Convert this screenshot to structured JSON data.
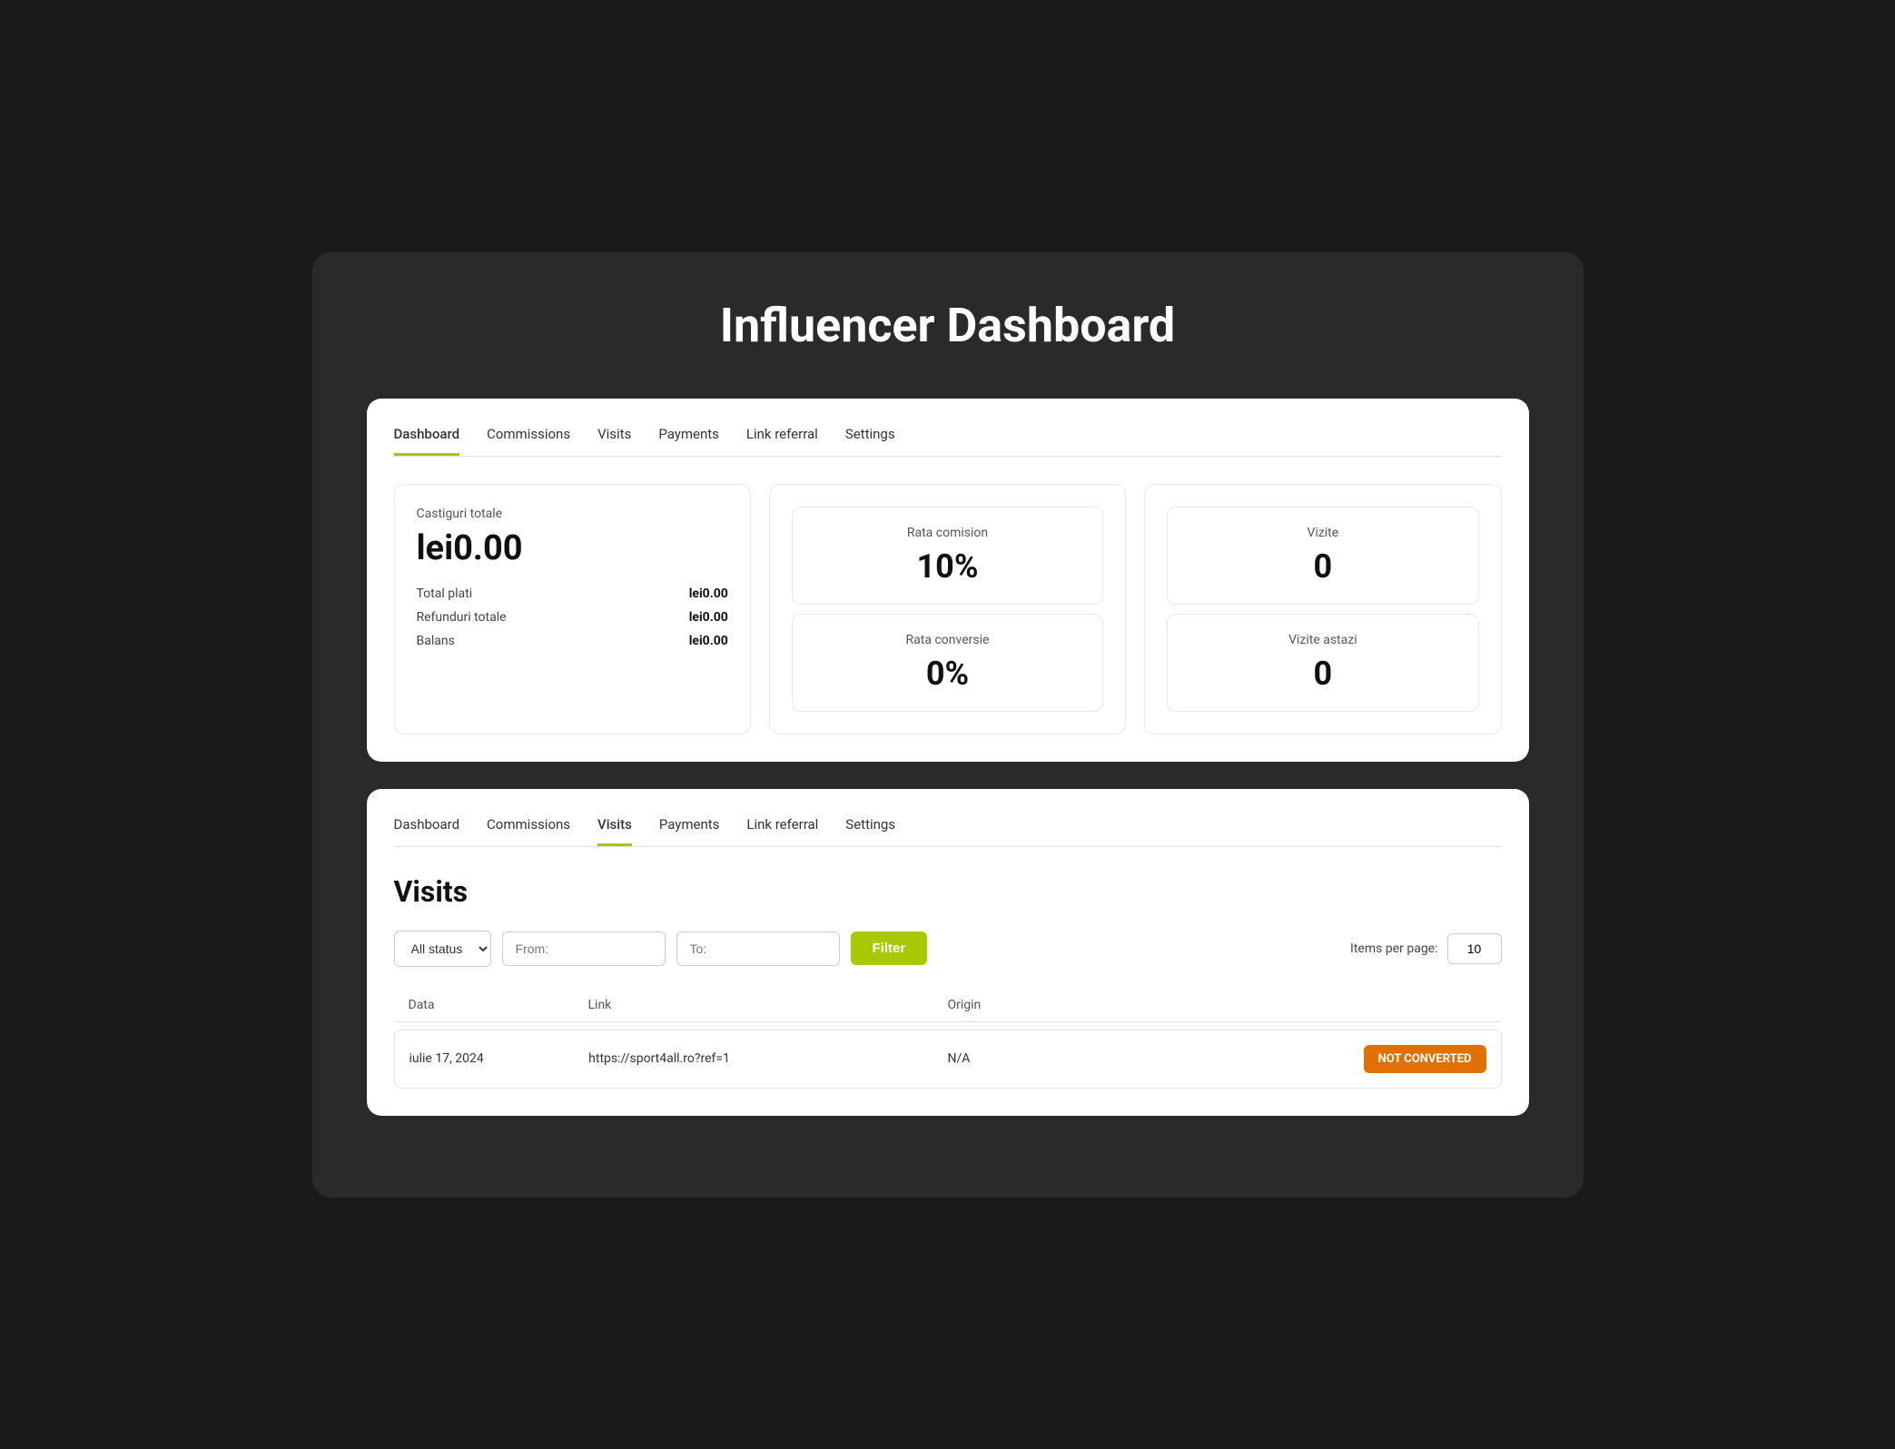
{
  "page": {
    "title": "Influencer Dashboard",
    "background": "#2a2a2a"
  },
  "card1": {
    "tabs": [
      {
        "label": "Dashboard",
        "active": true
      },
      {
        "label": "Commissions",
        "active": false
      },
      {
        "label": "Visits",
        "active": false
      },
      {
        "label": "Payments",
        "active": false
      },
      {
        "label": "Link referral",
        "active": false
      },
      {
        "label": "Settings",
        "active": false
      }
    ],
    "earnings": {
      "label": "Castiguri totale",
      "value": "lei0.00",
      "rows": [
        {
          "label": "Total plati",
          "value": "lei0.00"
        },
        {
          "label": "Refunduri totale",
          "value": "lei0.00"
        },
        {
          "label": "Balans",
          "value": "lei0.00"
        }
      ]
    },
    "commission": {
      "rata_label": "Rata comision",
      "rata_value": "10%",
      "conversie_label": "Rata conversie",
      "conversie_value": "0%"
    },
    "visits": {
      "vizite_label": "Vizite",
      "vizite_value": "0",
      "vizite_astazi_label": "Vizite astazi",
      "vizite_astazi_value": "0"
    }
  },
  "card2": {
    "tabs": [
      {
        "label": "Dashboard",
        "active": false
      },
      {
        "label": "Commissions",
        "active": false
      },
      {
        "label": "Visits",
        "active": true
      },
      {
        "label": "Payments",
        "active": false
      },
      {
        "label": "Link referral",
        "active": false
      },
      {
        "label": "Settings",
        "active": false
      }
    ],
    "visits_section": {
      "title": "Visits",
      "filter": {
        "status_label": "All status",
        "from_placeholder": "From:",
        "to_placeholder": "To:",
        "button_label": "Filter",
        "items_per_page_label": "Items per page:",
        "items_per_page_value": "10"
      },
      "table": {
        "headers": [
          "Data",
          "Link",
          "Origin",
          ""
        ],
        "rows": [
          {
            "date": "iulie 17, 2024",
            "link": "https://sport4all.ro?ref=1",
            "origin": "N/A",
            "status": "NOT CONVERTED"
          }
        ]
      }
    }
  }
}
